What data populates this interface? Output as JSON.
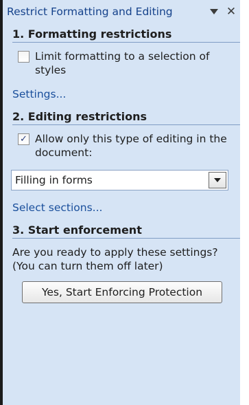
{
  "pane": {
    "title": "Restrict Formatting and Editing",
    "dropdown_icon": "triangle-down-icon",
    "close_icon": "close-icon",
    "close_glyph": "✕"
  },
  "formatting": {
    "heading": "1. Formatting restrictions",
    "checkbox_label": "Limit formatting to a selection of styles",
    "checked": false,
    "settings_link": "Settings..."
  },
  "editing": {
    "heading": "2. Editing restrictions",
    "checkbox_label": "Allow only this type of editing in the document:",
    "checked": true,
    "check_glyph": "✓",
    "dropdown_value": "Filling in forms",
    "select_sections_link": "Select sections..."
  },
  "enforcement": {
    "heading": "3. Start enforcement",
    "prompt": "Are you ready to apply these settings? (You can turn them off later)",
    "button_label": "Yes, Start Enforcing Protection"
  },
  "colors": {
    "pane_bg": "#d6e4f5",
    "title_text": "#15428b",
    "link_text": "#1a4f9c"
  }
}
